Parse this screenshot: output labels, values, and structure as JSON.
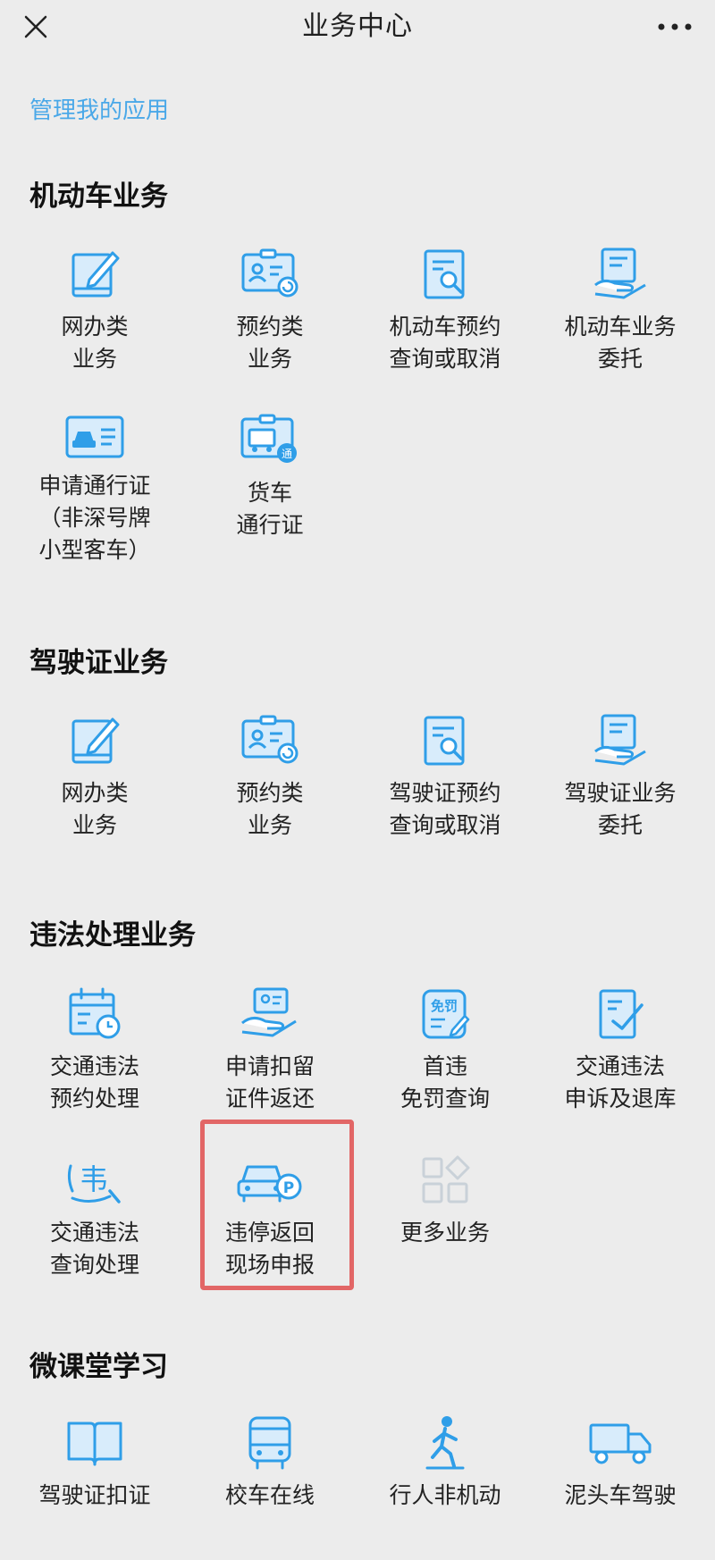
{
  "header": {
    "title": "业务中心",
    "close_icon": "close-icon",
    "more_icon": "more-icon"
  },
  "manage_link": "管理我的应用",
  "sections": [
    {
      "title": "机动车业务",
      "items": [
        {
          "label": "网办类\n业务",
          "icon": "edit-pad-icon"
        },
        {
          "label": "预约类\n业务",
          "icon": "id-card-refresh-icon"
        },
        {
          "label": "机动车预约\n查询或取消",
          "icon": "document-search-icon"
        },
        {
          "label": "机动车业务\n委托",
          "icon": "hand-document-icon"
        },
        {
          "label": "申请通行证\n（非深号牌\n小型客车）",
          "icon": "car-card-icon"
        },
        {
          "label": "货车\n通行证",
          "icon": "truck-pass-icon"
        }
      ]
    },
    {
      "title": "驾驶证业务",
      "items": [
        {
          "label": "网办类\n业务",
          "icon": "edit-pad-icon"
        },
        {
          "label": "预约类\n业务",
          "icon": "id-card-refresh-icon"
        },
        {
          "label": "驾驶证预约\n查询或取消",
          "icon": "document-search-icon"
        },
        {
          "label": "驾驶证业务\n委托",
          "icon": "hand-document-icon"
        }
      ]
    },
    {
      "title": "违法处理业务",
      "items": [
        {
          "label": "交通违法\n预约处理",
          "icon": "calendar-clock-icon"
        },
        {
          "label": "申请扣留\n证件返还",
          "icon": "hand-card-icon"
        },
        {
          "label": "首违\n免罚查询",
          "icon": "exemption-icon"
        },
        {
          "label": "交通违法\n申诉及退库",
          "icon": "document-check-icon"
        },
        {
          "label": "交通违法\n查询处理",
          "icon": "violation-search-icon"
        },
        {
          "label": "违停返回\n现场申报",
          "icon": "parking-car-icon"
        },
        {
          "label": "更多业务",
          "icon": "grid-more-icon"
        }
      ]
    },
    {
      "title": "微课堂学习",
      "items": [
        {
          "label": "驾驶证扣证",
          "icon": "book-icon"
        },
        {
          "label": "校车在线",
          "icon": "bus-icon"
        },
        {
          "label": "行人非机动",
          "icon": "walking-person-icon"
        },
        {
          "label": "泥头车驾驶",
          "icon": "dump-truck-icon"
        }
      ]
    }
  ],
  "colors": {
    "accent": "#4aa8e8",
    "icon_blue": "#2f9ee8",
    "highlight": "#e26666",
    "background": "#ececec"
  }
}
